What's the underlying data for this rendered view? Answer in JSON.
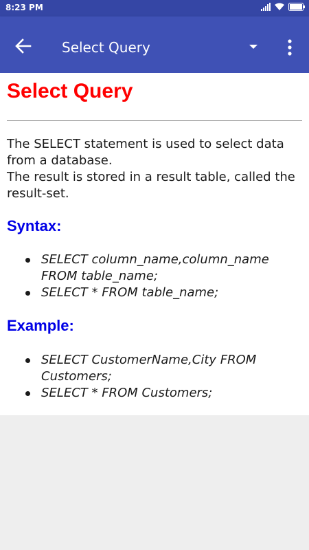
{
  "status_bar": {
    "time": "8:23 PM",
    "icons": [
      "signal-icon",
      "wifi-icon",
      "battery-icon"
    ]
  },
  "app_bar": {
    "title": "Select Query",
    "icons": [
      "back-arrow-icon",
      "dropdown-arrow-icon",
      "overflow-menu-icon"
    ],
    "color": "#3f51b5"
  },
  "content": {
    "heading": "Select Query",
    "intro_lines": [
      "The SELECT statement is used to select data from a database.",
      "The result is stored in a result table, called the result-set."
    ],
    "syntax": {
      "title": "Syntax:",
      "items": [
        "SELECT column_name,column_name FROM table_name;",
        "SELECT * FROM table_name;"
      ]
    },
    "example": {
      "title": "Example:",
      "items": [
        "SELECT CustomerName,City FROM Customers;",
        "SELECT * FROM Customers;"
      ]
    },
    "colors": {
      "heading": "#ff0000",
      "section": "#0000e6"
    }
  }
}
